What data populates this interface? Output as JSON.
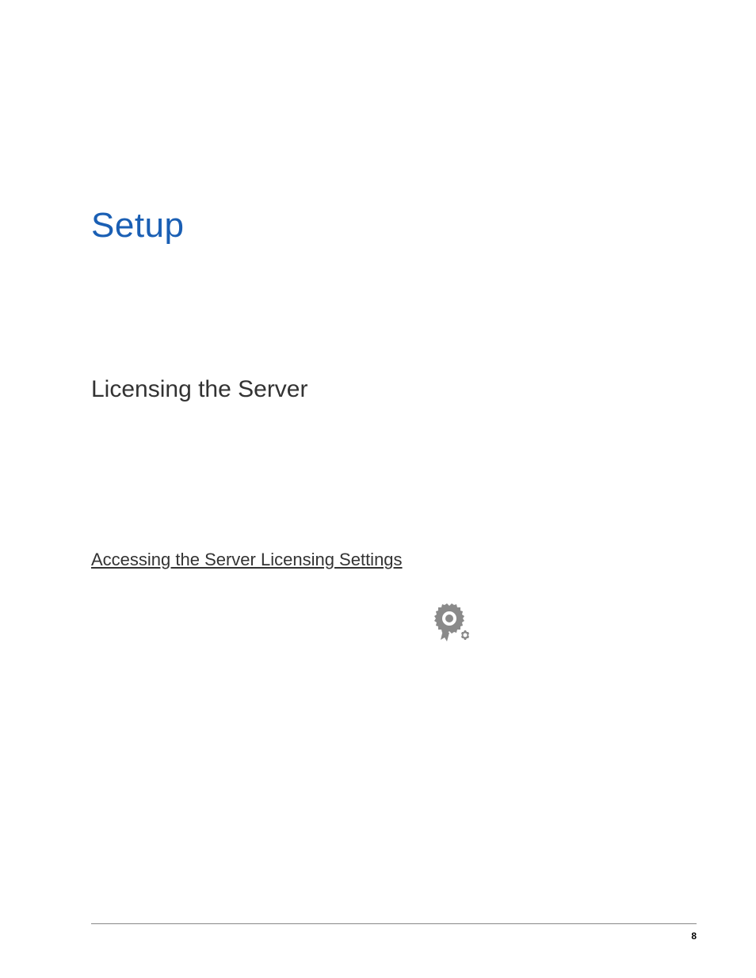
{
  "heading": {
    "chapter": "Setup",
    "section": "Licensing the Server",
    "subsection": "Accessing the Server Licensing Settings"
  },
  "page_number": "8"
}
